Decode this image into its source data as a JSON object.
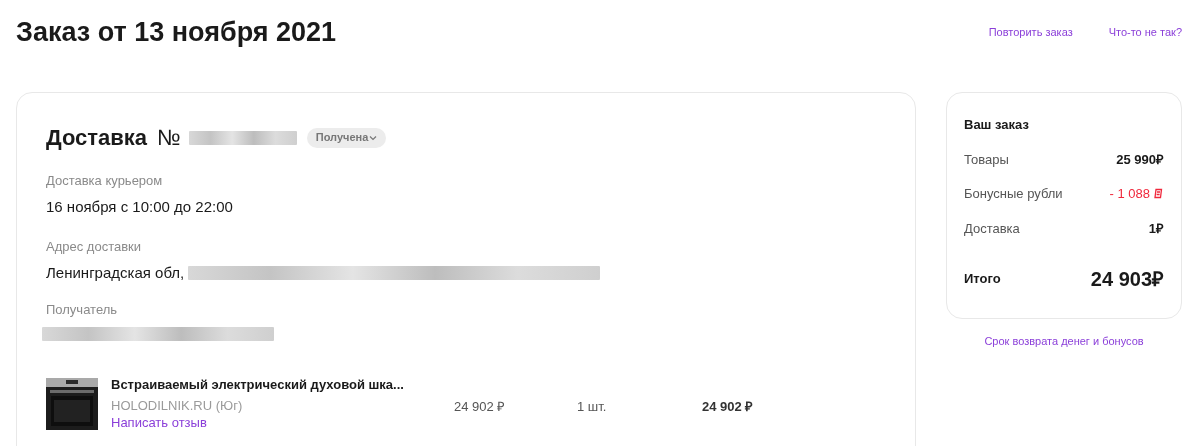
{
  "title": "Заказ от 13 ноября 2021",
  "header_links": [
    "Повторить заказ",
    "Что-то не так?"
  ],
  "delivery": {
    "heading": "Доставка",
    "number_sign": "№",
    "status": "Получена",
    "method_label": "Доставка курьером",
    "method_value": "16 ноября с 10:00 до 22:00",
    "address_label": "Адрес доставки",
    "address_value": "Ленинградская обл,",
    "recipient_label": "Получатель"
  },
  "item": {
    "kind": "picture",
    "name": "Встраиваемый электрический духовой шка...",
    "seller": "HOLODILNIK.RU (Юг)",
    "review_link": "Написать отзыв",
    "price": "24 902 ₽",
    "quantity": "1 шт.",
    "total": "24 902 ₽"
  },
  "summary": {
    "title": "Ваш заказ",
    "rows": [
      {
        "label": "Товары",
        "value": "25 990₽",
        "kind": "plain"
      },
      {
        "label": "Бонусные рубли",
        "value": "- 1 088",
        "kind": "bonus"
      },
      {
        "label": "Доставка",
        "value": "1₽",
        "kind": "plain"
      }
    ],
    "total_label": "Итого",
    "total_value": "24 903₽"
  },
  "refund_link": "Срок возврата денег и бонусов"
}
